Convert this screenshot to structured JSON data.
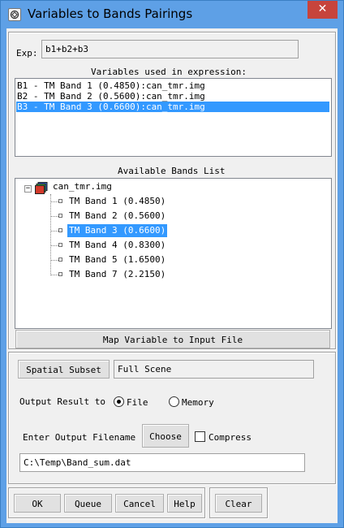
{
  "window": {
    "title": "Variables to Bands Pairings",
    "close_glyph": "✕"
  },
  "expression": {
    "label": "Exp:",
    "value": "b1+b2+b3"
  },
  "variables": {
    "heading": "Variables used in expression:",
    "items": [
      {
        "text": "B1 - TM Band 1 (0.4850):can_tmr.img",
        "selected": false
      },
      {
        "text": "B2 - TM Band 2 (0.5600):can_tmr.img",
        "selected": false
      },
      {
        "text": "B3 - TM Band 3 (0.6600):can_tmr.img",
        "selected": true
      }
    ]
  },
  "bands": {
    "heading": "Available Bands List",
    "root": {
      "label": "can_tmr.img",
      "expander": "−"
    },
    "items": [
      {
        "label": "TM Band 1 (0.4850)",
        "selected": false
      },
      {
        "label": "TM Band 2 (0.5600)",
        "selected": false
      },
      {
        "label": "TM Band 3 (0.6600)",
        "selected": true
      },
      {
        "label": "TM Band 4 (0.8300)",
        "selected": false
      },
      {
        "label": "TM Band 5 (1.6500)",
        "selected": false
      },
      {
        "label": "TM Band 7 (2.2150)",
        "selected": false
      }
    ]
  },
  "map_button": "Map Variable to Input File",
  "subset": {
    "button": "Spatial Subset",
    "value": "Full Scene"
  },
  "output": {
    "label": "Output Result to",
    "options": [
      {
        "label": "File",
        "selected": true
      },
      {
        "label": "Memory",
        "selected": false
      }
    ]
  },
  "filename": {
    "label": "Enter Output Filename",
    "choose": "Choose",
    "compress_label": "Compress",
    "compress_checked": false,
    "value": "C:\\Temp\\Band_sum.dat"
  },
  "footer": {
    "ok": "OK",
    "queue": "Queue",
    "cancel": "Cancel",
    "help": "Help",
    "clear": "Clear"
  },
  "colors": {
    "titlebar": "#5ea0e6",
    "selection": "#3399ff",
    "close": "#c7443c",
    "client": "#f0f0f0"
  }
}
